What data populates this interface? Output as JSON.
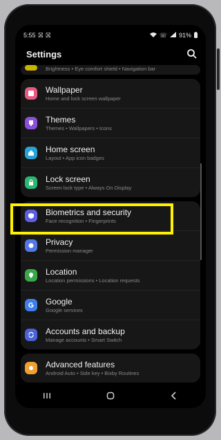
{
  "status_bar": {
    "time": "5:55",
    "left_icons": [
      "notification-icon",
      "notification-icon"
    ],
    "right_icons": [
      "wifi-icon",
      "call-icon",
      "signal-icon"
    ],
    "battery": "91%"
  },
  "header": {
    "title": "Settings",
    "search_icon": "search-icon"
  },
  "partial_row": {
    "subtitle": "Brightness • Eye comfort shield • Navigation bar",
    "color": "#c8b400"
  },
  "items": [
    {
      "title": "Wallpaper",
      "subtitle": "Home and lock screen wallpaper",
      "icon": "wallpaper-icon",
      "color": "#e65a82"
    },
    {
      "title": "Themes",
      "subtitle": "Themes • Wallpapers • Icons",
      "icon": "themes-icon",
      "color": "#8c4fd9"
    },
    {
      "title": "Home screen",
      "subtitle": "Layout • App icon badges",
      "icon": "home-icon",
      "color": "#29a3d6"
    },
    {
      "title": "Lock screen",
      "subtitle": "Screen lock type • Always On Display",
      "icon": "lock-icon",
      "color": "#2bb673"
    },
    {
      "title": "Biometrics and security",
      "subtitle": "Face recognition • Fingerprints",
      "icon": "shield-icon",
      "color": "#5b5fe0"
    },
    {
      "title": "Privacy",
      "subtitle": "Permission manager",
      "icon": "privacy-icon",
      "color": "#5477e6"
    },
    {
      "title": "Location",
      "subtitle": "Location permissions • Location requests",
      "icon": "location-icon",
      "color": "#3aa84a"
    },
    {
      "title": "Google",
      "subtitle": "Google services",
      "icon": "google-icon",
      "color": "#3f7de8"
    },
    {
      "title": "Accounts and backup",
      "subtitle": "Manage accounts • Smart Switch",
      "icon": "sync-icon",
      "color": "#4a63d6"
    },
    {
      "title": "Advanced features",
      "subtitle": "Android Auto • Side key • Bixby Routines",
      "icon": "star-gear-icon",
      "color": "#f0a030"
    }
  ],
  "nav": [
    "recents-icon",
    "home-icon",
    "back-icon"
  ],
  "highlight_color": "#fff200"
}
